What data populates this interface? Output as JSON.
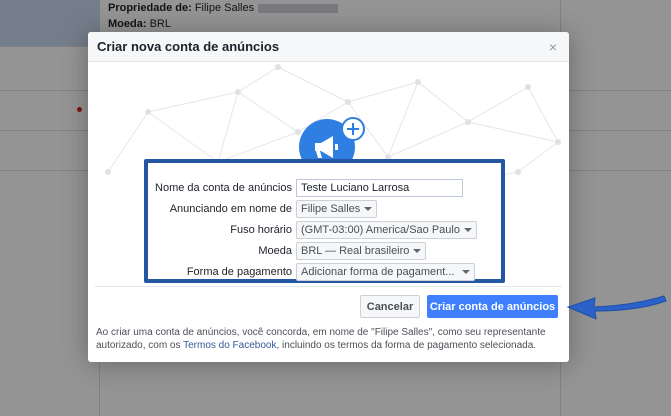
{
  "background": {
    "owner_label": "Propriedade de:",
    "owner_value": "Filipe Salles",
    "currency_label": "Moeda:",
    "currency_value": "BRL"
  },
  "modal": {
    "title": "Criar nova conta de anúncios",
    "close_glyph": "×"
  },
  "form": {
    "account_name": {
      "label": "Nome da conta de anúncios",
      "value": "Teste Luciano Larrosa"
    },
    "advertising_on_behalf": {
      "label": "Anunciando em nome de",
      "value": "Filipe Salles"
    },
    "timezone": {
      "label": "Fuso horário",
      "value": "(GMT-03:00) America/Sao Paulo"
    },
    "currency": {
      "label": "Moeda",
      "value": "BRL — Real brasileiro"
    },
    "payment_method": {
      "label": "Forma de pagamento",
      "value": "Adicionar forma de pagament..."
    }
  },
  "buttons": {
    "cancel": "Cancelar",
    "create": "Criar conta de anúncios"
  },
  "footer": {
    "text_before": "Ao criar uma conta de anúncios, você concorda, em nome de \"Filipe Salles\", como seu representante autorizado, com os ",
    "link": "Termos do Facebook",
    "text_after": ", incluindo os termos da forma de pagamento selecionada."
  },
  "colors": {
    "accent_blue": "#4080ff",
    "form_border": "#2456a4",
    "icon_blue": "#2f7fe3",
    "arrow_blue": "#2a62c9"
  }
}
